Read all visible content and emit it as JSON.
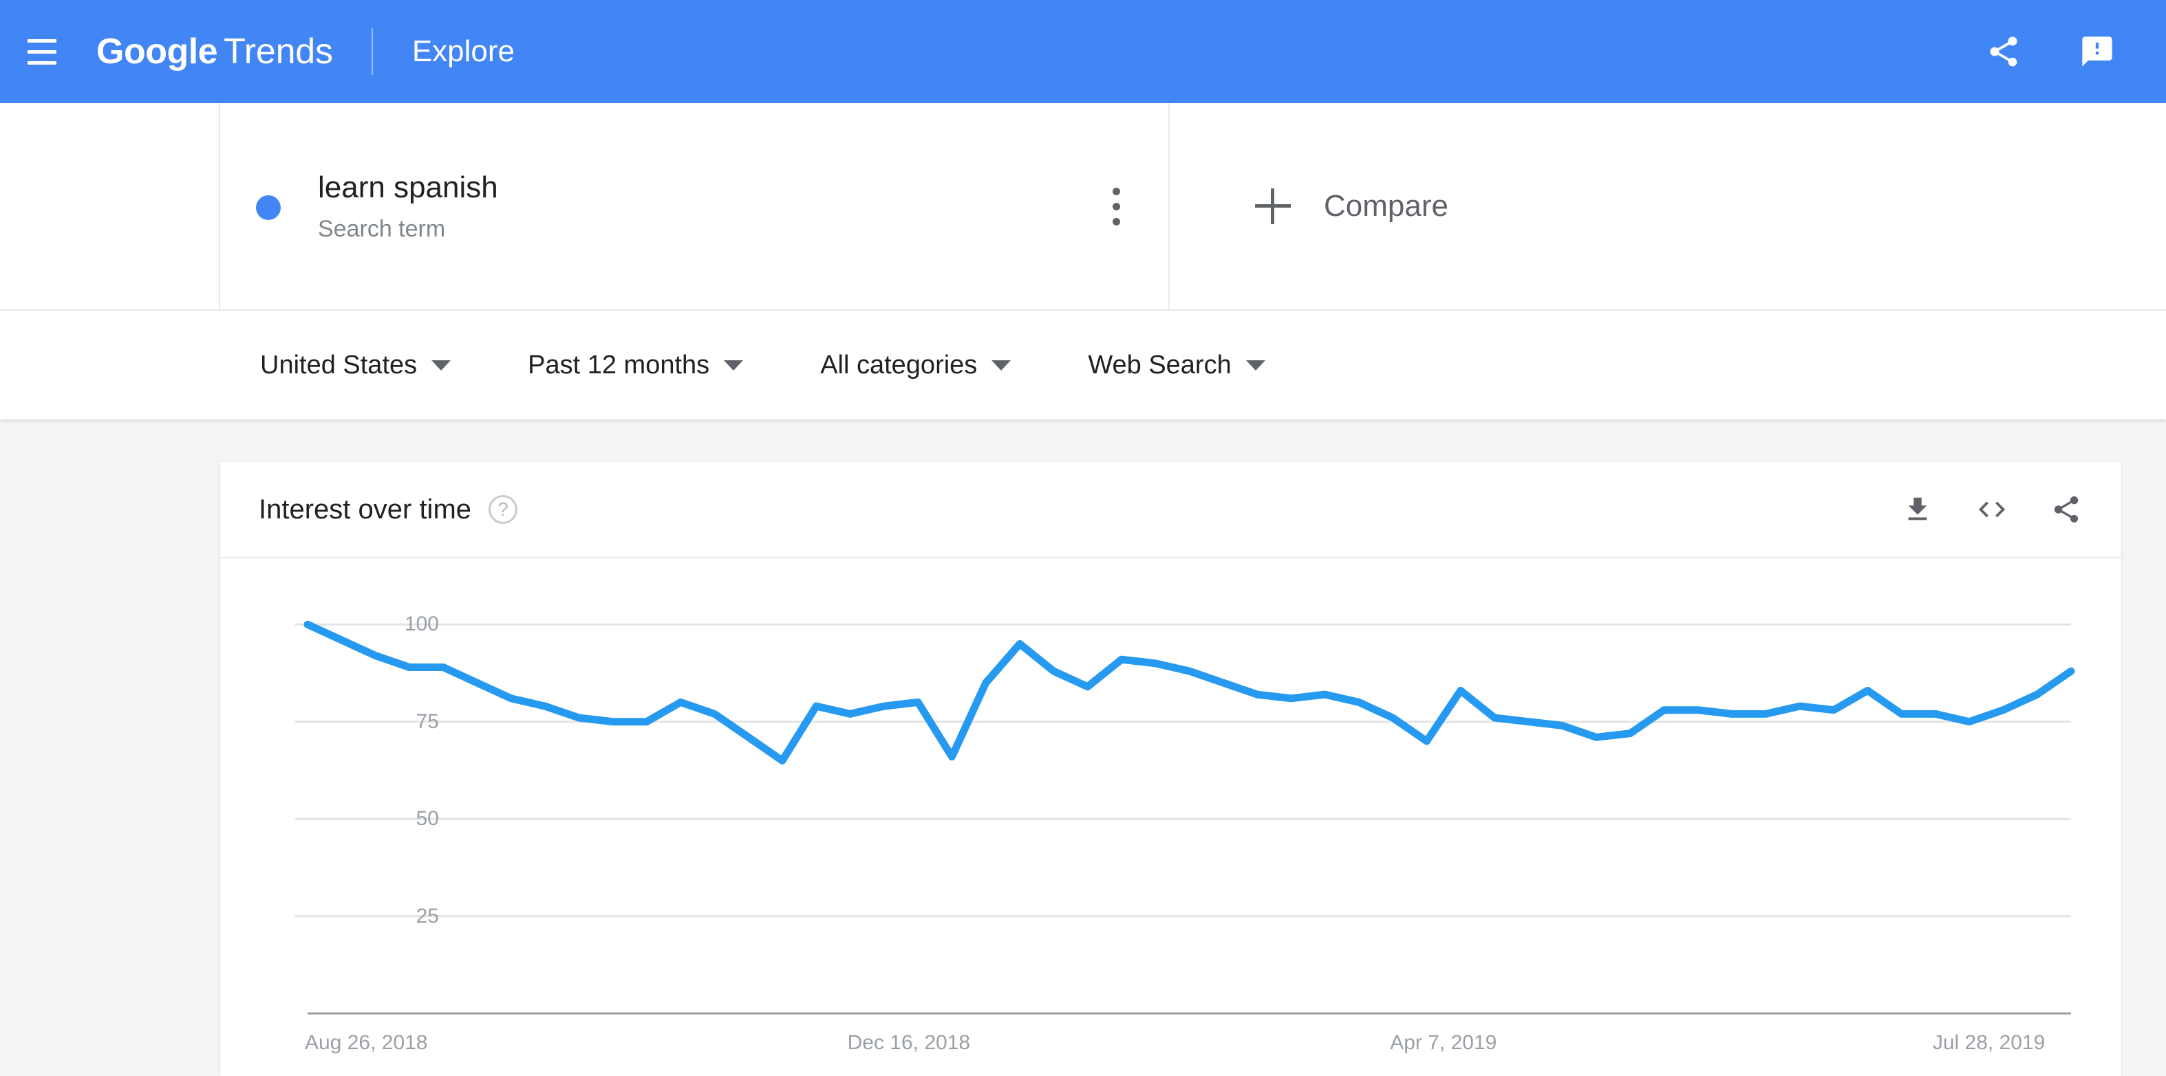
{
  "appbar": {
    "menu_icon": "hamburger-menu-icon",
    "brand_primary": "Google",
    "brand_secondary": "Trends",
    "nav_label": "Explore",
    "share_icon": "share-icon",
    "feedback_icon": "feedback-icon"
  },
  "search_term": {
    "title": "learn spanish",
    "subtitle": "Search term",
    "dot_color": "#4285f4",
    "menu_icon": "more-vert-icon"
  },
  "compare": {
    "label": "Compare",
    "plus_icon": "plus-icon"
  },
  "filters": [
    {
      "label": "United States",
      "name": "location-filter"
    },
    {
      "label": "Past 12 months",
      "name": "time-range-filter"
    },
    {
      "label": "All categories",
      "name": "category-filter"
    },
    {
      "label": "Web Search",
      "name": "search-type-filter"
    }
  ],
  "chart_card": {
    "title": "Interest over time",
    "help_icon": "help-circle-icon",
    "download_icon": "download-icon",
    "embed_icon": "embed-code-icon",
    "share_icon": "share-icon"
  },
  "chart_data": {
    "type": "line",
    "title": "Interest over time",
    "xlabel": "",
    "ylabel": "",
    "series_name": "learn spanish",
    "line_color": "#2699f0",
    "grid": true,
    "legend_position": "none",
    "ylim": [
      0,
      108
    ],
    "yticks": [
      100,
      75,
      50,
      25
    ],
    "xtick_labels": [
      "Aug 26, 2018",
      "Dec 16, 2018",
      "Apr 7, 2019",
      "Jul 28, 2019"
    ],
    "xtick_indices": [
      0,
      16,
      32,
      48
    ],
    "x": [
      "Aug 26, 2018",
      "Sep 2, 2018",
      "Sep 9, 2018",
      "Sep 16, 2018",
      "Sep 23, 2018",
      "Sep 30, 2018",
      "Oct 7, 2018",
      "Oct 14, 2018",
      "Oct 21, 2018",
      "Oct 28, 2018",
      "Nov 4, 2018",
      "Nov 11, 2018",
      "Nov 18, 2018",
      "Nov 25, 2018",
      "Dec 2, 2018",
      "Dec 9, 2018",
      "Dec 16, 2018",
      "Dec 23, 2018",
      "Dec 30, 2018",
      "Jan 6, 2019",
      "Jan 13, 2019",
      "Jan 20, 2019",
      "Jan 27, 2019",
      "Feb 3, 2019",
      "Feb 10, 2019",
      "Feb 17, 2019",
      "Feb 24, 2019",
      "Mar 3, 2019",
      "Mar 10, 2019",
      "Mar 17, 2019",
      "Mar 24, 2019",
      "Mar 31, 2019",
      "Apr 7, 2019",
      "Apr 14, 2019",
      "Apr 21, 2019",
      "Apr 28, 2019",
      "May 5, 2019",
      "May 12, 2019",
      "May 19, 2019",
      "May 26, 2019",
      "Jun 2, 2019",
      "Jun 9, 2019",
      "Jun 16, 2019",
      "Jun 23, 2019",
      "Jun 30, 2019",
      "Jul 7, 2019",
      "Jul 14, 2019",
      "Jul 21, 2019",
      "Jul 28, 2019",
      "Aug 4, 2019",
      "Aug 11, 2019",
      "Aug 18, 2019",
      "Aug 25, 2019"
    ],
    "values": [
      100,
      96,
      92,
      89,
      89,
      85,
      81,
      79,
      76,
      75,
      75,
      80,
      77,
      71,
      65,
      79,
      77,
      79,
      80,
      66,
      85,
      95,
      88,
      84,
      91,
      90,
      88,
      85,
      82,
      81,
      82,
      80,
      76,
      70,
      83,
      76,
      75,
      74,
      71,
      72,
      78,
      78,
      77,
      77,
      79,
      78,
      83,
      77,
      77,
      75,
      78,
      82,
      88
    ]
  }
}
